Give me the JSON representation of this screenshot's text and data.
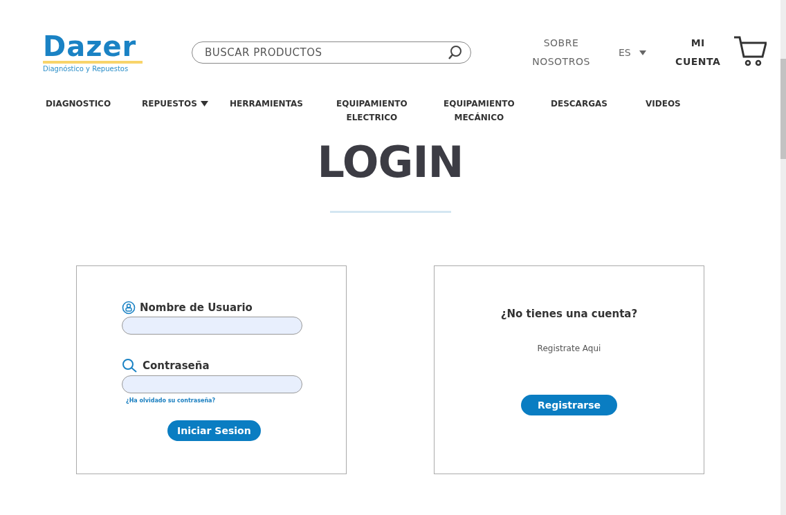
{
  "header": {
    "logo": {
      "name": "Dazer",
      "tagline": "Diagnóstico y Repuestos"
    },
    "search": {
      "placeholder": "BUSCAR PRODUCTOS"
    },
    "about": "SOBRE NOSOTROS",
    "language": "ES",
    "account": "MI CUENTA"
  },
  "nav": [
    {
      "label": "DIAGNOSTICO",
      "dropdown": false
    },
    {
      "label": "REPUESTOS",
      "dropdown": true
    },
    {
      "label": "HERRAMIENTAS",
      "dropdown": false
    },
    {
      "label": "EQUIPAMIENTO ELECTRICO",
      "dropdown": false
    },
    {
      "label": "EQUIPAMIENTO MECÁNICO",
      "dropdown": false
    },
    {
      "label": "DESCARGAS",
      "dropdown": false
    },
    {
      "label": "VIDEOS",
      "dropdown": false
    }
  ],
  "title": "LOGIN",
  "login": {
    "fields": [
      {
        "kind": "user",
        "label": "Nombre de Usuario"
      },
      {
        "kind": "password",
        "label": "Contraseña"
      }
    ],
    "forgot": "¿Ha olvidado su contraseña?",
    "submit": "Iniciar Sesion"
  },
  "register": {
    "heading": "¿No tienes una cuenta?",
    "subtext": "Registrate Aqui",
    "button": "Registrarse"
  }
}
